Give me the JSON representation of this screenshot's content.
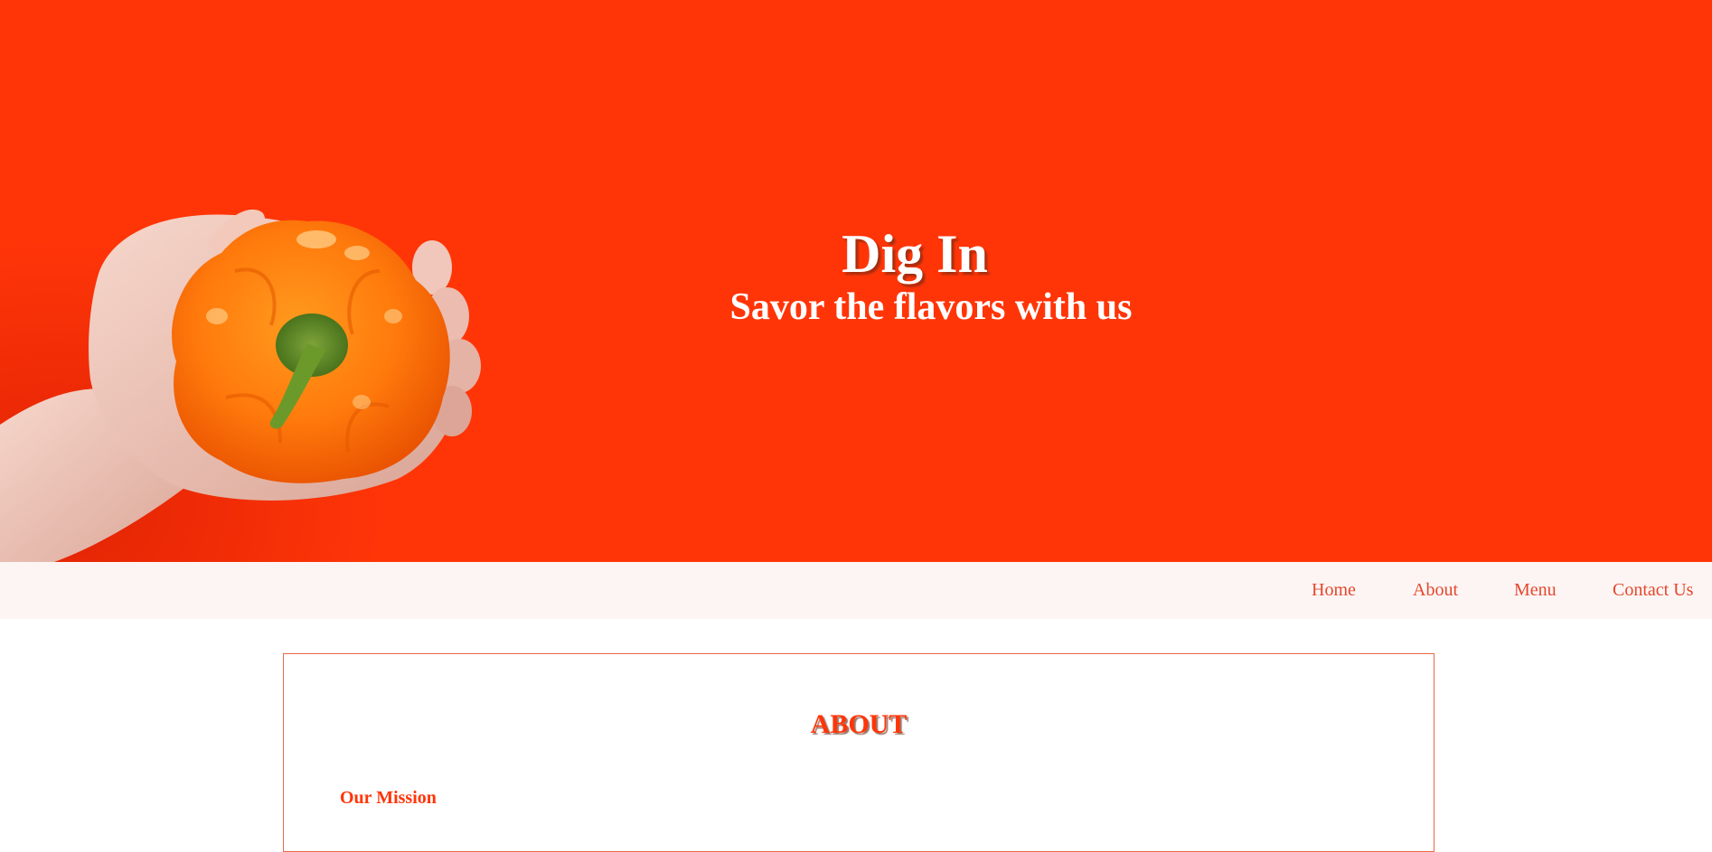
{
  "hero": {
    "title": "Dig In",
    "subtitle": "Savor the flavors with us",
    "background_color": "#ff3508",
    "photo": "hand-holding-orange-bell-pepper"
  },
  "nav": {
    "items": [
      {
        "label": "Home"
      },
      {
        "label": "About"
      },
      {
        "label": "Menu"
      },
      {
        "label": "Contact Us"
      }
    ],
    "link_color": "#e5472c",
    "background_color": "#fcf5f4"
  },
  "about": {
    "heading": "ABOUT",
    "mission_heading": "Our Mission",
    "accent_color": "#ff3508"
  }
}
